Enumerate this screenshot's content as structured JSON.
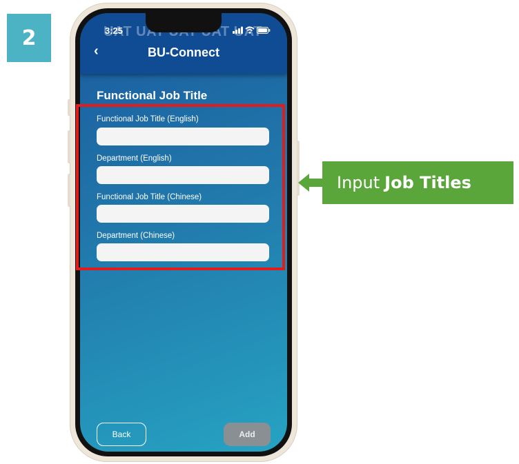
{
  "step_number": "2",
  "status_bar": {
    "time": "3:25",
    "watermark": "UAT UAT UAT UAT UAT"
  },
  "header": {
    "back_icon": "chevron-left-icon",
    "title": "BU-Connect"
  },
  "section_title": "Functional Job Title",
  "fields": [
    {
      "label": "Functional Job Title (English)",
      "value": ""
    },
    {
      "label": "Department (English)",
      "value": ""
    },
    {
      "label": "Functional Job Title (Chinese)",
      "value": ""
    },
    {
      "label": "Department (Chinese)",
      "value": ""
    }
  ],
  "buttons": {
    "back_label": "Back",
    "add_label": "Add"
  },
  "callout": {
    "prefix": "Input",
    "bold": "Job Titles"
  },
  "colors": {
    "step_badge": "#4bb3c4",
    "header": "#104c94",
    "highlight": "#e41b1b",
    "callout": "#5ba63a",
    "add_button": "#8a8f94"
  }
}
